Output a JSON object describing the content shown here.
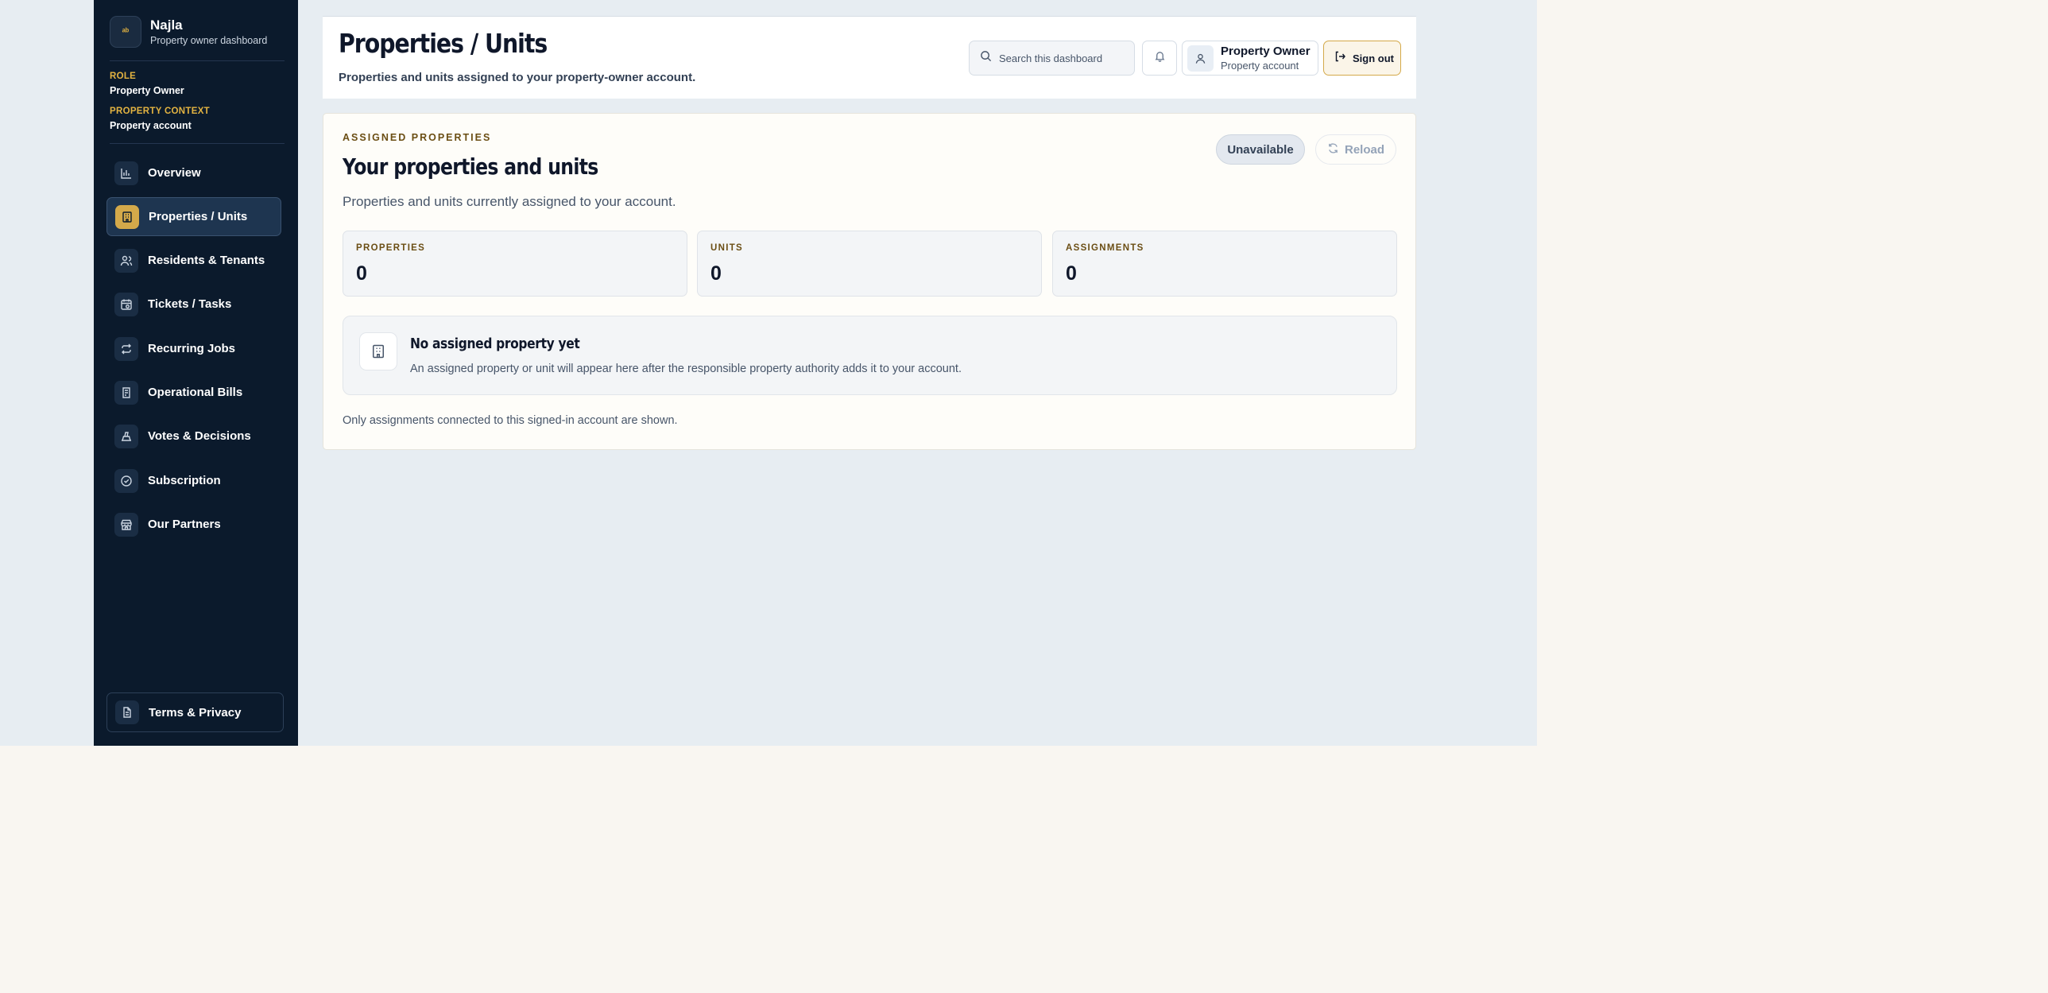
{
  "brand": {
    "logo_text": "ᵃᵇ",
    "name": "Najla",
    "subtitle": "Property owner dashboard"
  },
  "context": {
    "role_label": "ROLE",
    "role_value": "Property Owner",
    "property_label": "PROPERTY CONTEXT",
    "property_value": "Property account"
  },
  "sidebar": {
    "items": [
      {
        "label": "Overview",
        "icon": "bar-chart-icon"
      },
      {
        "label": "Properties / Units",
        "icon": "building-icon",
        "active": true
      },
      {
        "label": "Residents & Tenants",
        "icon": "users-icon"
      },
      {
        "label": "Tickets / Tasks",
        "icon": "calendar-icon"
      },
      {
        "label": "Recurring Jobs",
        "icon": "repeat-icon"
      },
      {
        "label": "Operational Bills",
        "icon": "receipt-icon"
      },
      {
        "label": "Votes & Decisions",
        "icon": "ballot-icon"
      },
      {
        "label": "Subscription",
        "icon": "check-circle-icon"
      },
      {
        "label": "Our Partners",
        "icon": "store-icon"
      }
    ],
    "bottom": {
      "label": "Terms & Privacy",
      "icon": "document-icon"
    }
  },
  "header": {
    "title": "Properties / Units",
    "subtitle": "Properties and units assigned to your property-owner account.",
    "search_placeholder": "Search this dashboard",
    "user_name": "Property Owner",
    "user_sub": "Property account",
    "signout_label": "Sign out"
  },
  "card": {
    "eyebrow": "ASSIGNED PROPERTIES",
    "title": "Your properties and units",
    "subtitle": "Properties and units currently assigned to your account.",
    "status_pill": "Unavailable",
    "reload_label": "Reload",
    "stats": [
      {
        "label": "PROPERTIES",
        "value": "0"
      },
      {
        "label": "UNITS",
        "value": "0"
      },
      {
        "label": "ASSIGNMENTS",
        "value": "0"
      }
    ],
    "empty": {
      "title": "No assigned property yet",
      "text": "An assigned property or unit will appear here after the responsible property authority adds it to your account."
    },
    "footnote": "Only assignments connected to this signed-in account are shown."
  },
  "colors": {
    "sidebar_bg": "#0b1a2c",
    "accent_gold": "#d4a94a",
    "page_bg": "#e7edf2",
    "card_bg": "#fefdf9"
  }
}
